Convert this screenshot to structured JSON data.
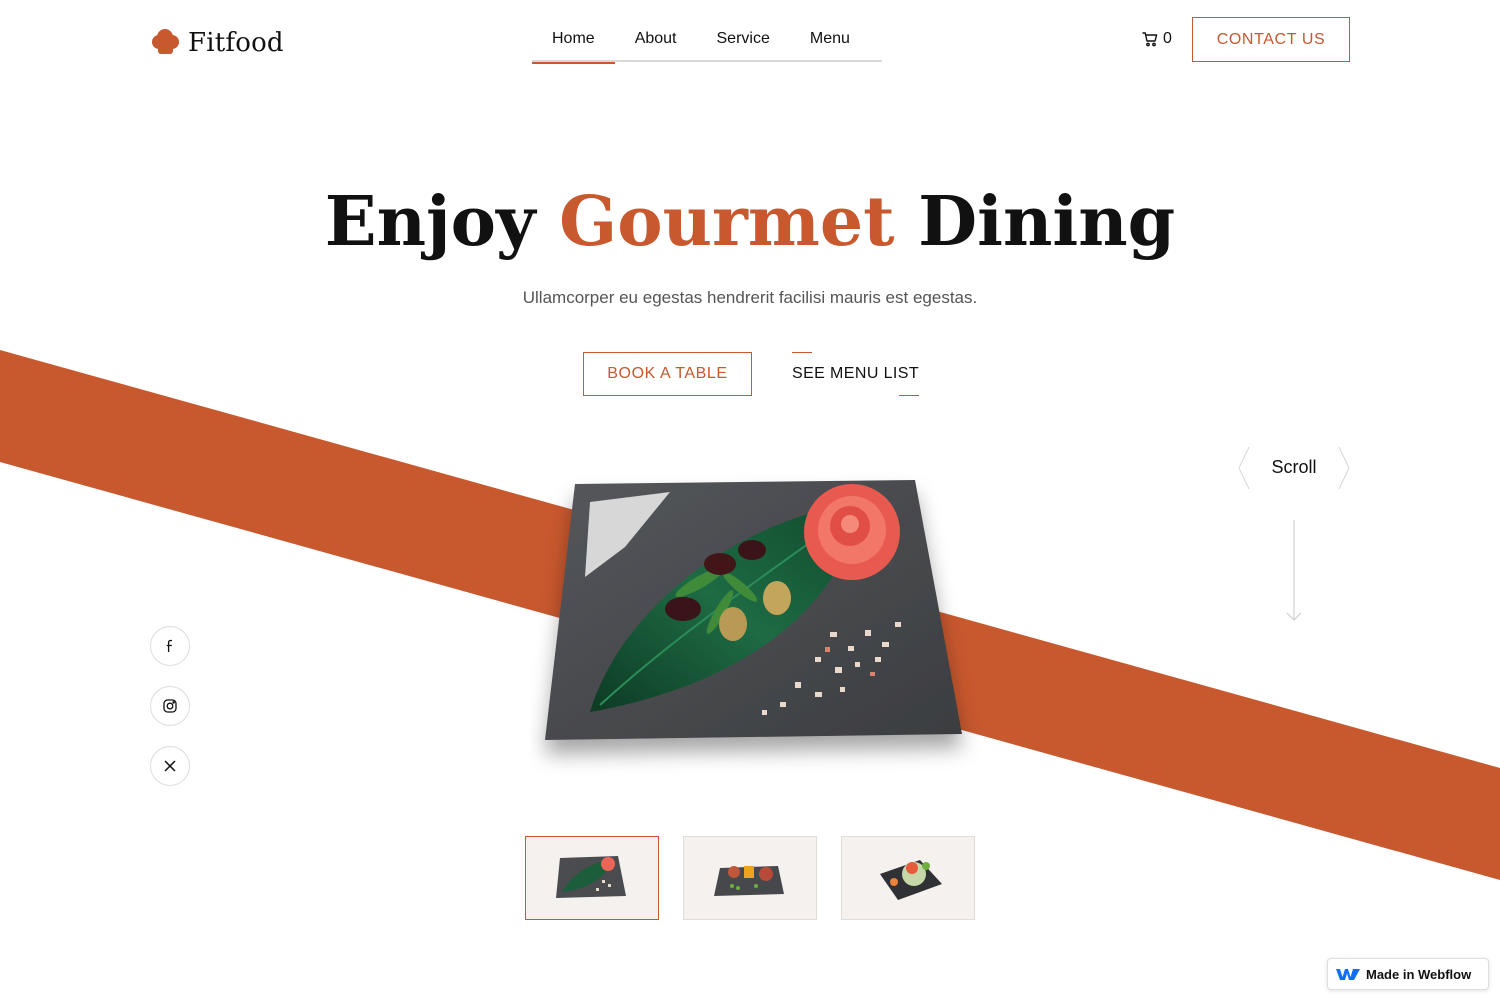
{
  "brand": {
    "name": "Fitfood",
    "accent_color": "#c8582e",
    "logo_icon": "chef-hat-icon"
  },
  "nav": {
    "items": [
      {
        "label": "Home",
        "active": true
      },
      {
        "label": "About",
        "active": false
      },
      {
        "label": "Service",
        "active": false
      },
      {
        "label": "Menu",
        "active": false
      }
    ]
  },
  "cart": {
    "icon": "cart-icon",
    "count": "0"
  },
  "header": {
    "contact_label": "CONTACT US"
  },
  "hero": {
    "title_part1": "Enjoy ",
    "title_accent": "Gourmet",
    "title_part2": " Dining",
    "subtitle": "Ullamcorper eu egestas hendrerit facilisi mauris est egestas.",
    "book_label": "BOOK A TABLE",
    "menu_label": "SEE MENU LIST"
  },
  "scroll": {
    "label": "Scroll",
    "icon": "arrow-down-icon"
  },
  "social": [
    {
      "name": "facebook",
      "icon": "facebook-icon"
    },
    {
      "name": "instagram",
      "icon": "instagram-icon"
    },
    {
      "name": "x",
      "icon": "x-icon"
    }
  ],
  "thumbnails": [
    {
      "name": "dish-1",
      "active": true
    },
    {
      "name": "dish-2",
      "active": false
    },
    {
      "name": "dish-3",
      "active": false
    }
  ],
  "badge": {
    "label": "Made in Webflow",
    "icon": "webflow-icon"
  }
}
